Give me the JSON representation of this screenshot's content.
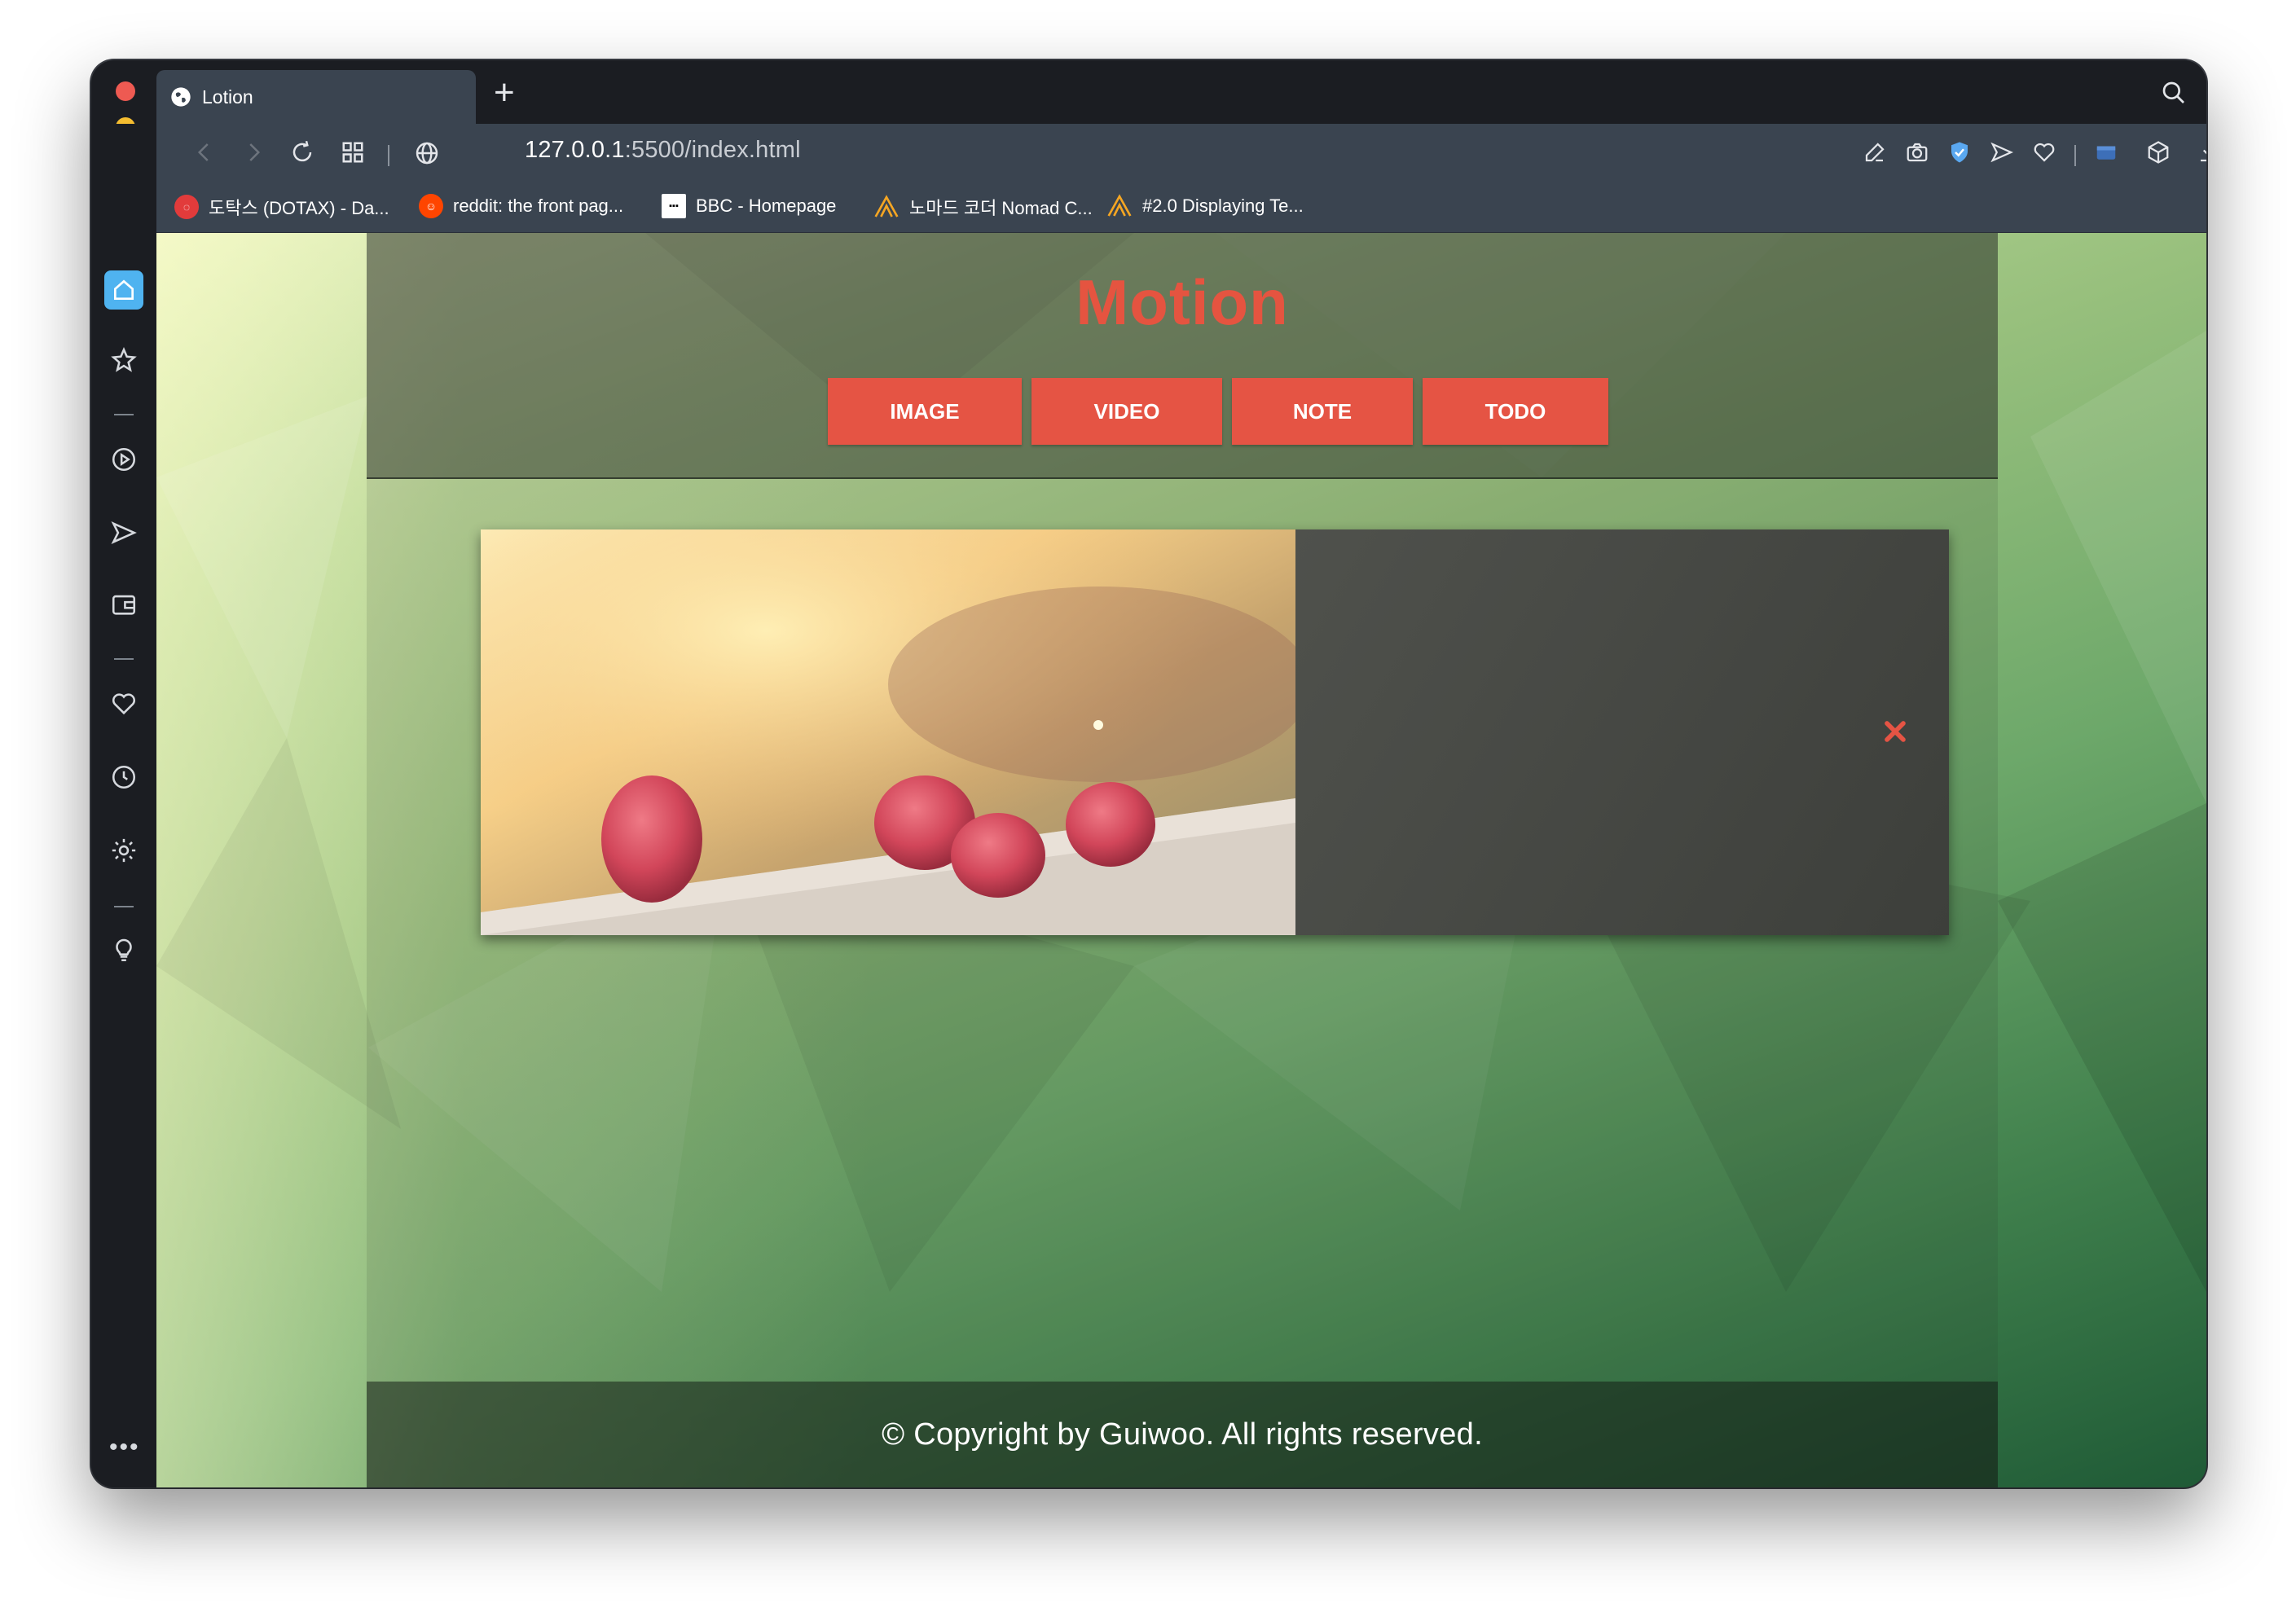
{
  "browser": {
    "tab": {
      "title": "Lotion"
    },
    "address_bar": {
      "host": "127.0.0.1",
      "rest": ":5500/index.html"
    },
    "bookmarks": [
      {
        "label": "도탁스 (DOTAX) - Da...",
        "icon": "dotax-icon",
        "color": "#e23b3b"
      },
      {
        "label": "reddit: the front pag...",
        "icon": "reddit-icon",
        "color": "#ff4500"
      },
      {
        "label": "BBC - Homepage",
        "icon": "bbc-icon",
        "color": "#ffffff"
      },
      {
        "label": "노마드 코더 Nomad C...",
        "icon": "nomad-coders-icon",
        "color": "#f5a623"
      },
      {
        "label": "#2.0 Displaying Te...",
        "icon": "nomad-coders-icon",
        "color": "#f5a623"
      }
    ]
  },
  "app": {
    "title": "Motion",
    "nav": [
      {
        "label": "IMAGE"
      },
      {
        "label": "VIDEO"
      },
      {
        "label": "NOTE"
      },
      {
        "label": "TODO"
      }
    ],
    "card": {
      "image": "raspberries-photo",
      "close_icon": "close-icon"
    },
    "footer": "© Copyright by Guiwoo. All rights reserved."
  },
  "colors": {
    "accent": "#e55444",
    "browser_chrome": "#3a4450",
    "sidebar": "#1b1d22",
    "home_active": "#4fb3f0"
  }
}
